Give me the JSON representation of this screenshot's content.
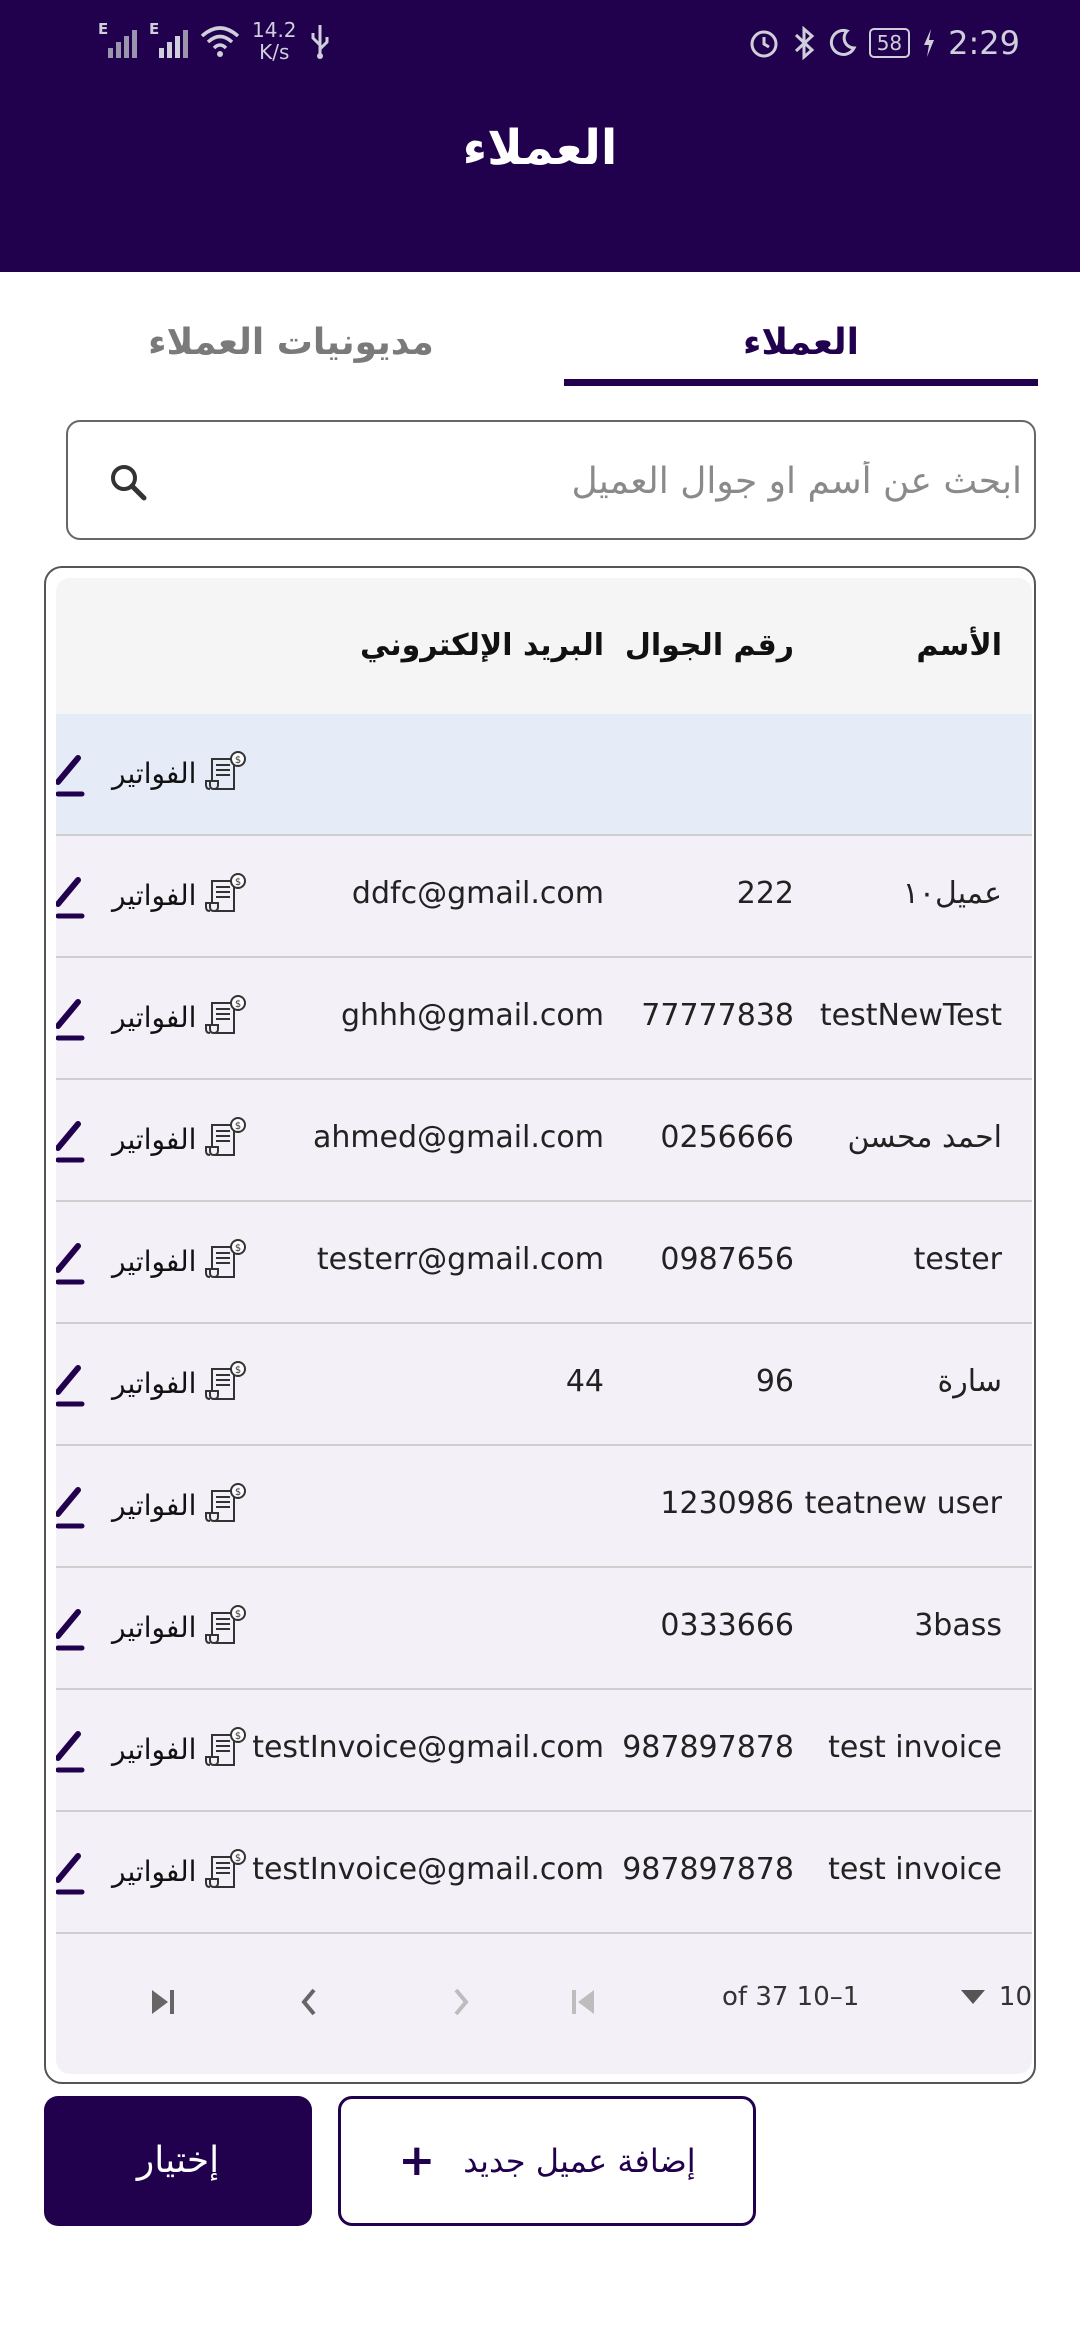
{
  "status_bar": {
    "network_1": "E",
    "network_2": "E",
    "speed_value": "14.2",
    "speed_unit": "K/s",
    "battery": "58",
    "time": "2:29"
  },
  "app_bar": {
    "title": "العملاء"
  },
  "tabs": [
    {
      "label": "العملاء",
      "active": true
    },
    {
      "label": "مديونيات العملاء",
      "active": false
    }
  ],
  "search": {
    "placeholder": "ابحث عن أسم او جوال العميل",
    "value": ""
  },
  "table": {
    "headers": {
      "name": "الأسم",
      "phone": "رقم الجوال",
      "email": "البريد الإلكتروني"
    },
    "invoice_label": "الفواتير",
    "rows": [
      {
        "name": "",
        "phone": "",
        "email": ""
      },
      {
        "name": "عميل١٠",
        "phone": "222",
        "email": "ddfc@gmail.com"
      },
      {
        "name": "testNewTest",
        "phone": "77777838",
        "email": "ghhh@gmail.com"
      },
      {
        "name": "احمد محسن",
        "phone": "0256666",
        "email": "ahmed@gmail.com"
      },
      {
        "name": "tester",
        "phone": "0987656",
        "email": "testerr@gmail.com"
      },
      {
        "name": "سارة",
        "phone": "96",
        "email": "44"
      },
      {
        "name": "teatnew user",
        "phone": "1230986",
        "email": ""
      },
      {
        "name": "3bass",
        "phone": "0333666",
        "email": ""
      },
      {
        "name": "test invoice",
        "phone": "987897878",
        "email": "testInvoice@gmail.com"
      },
      {
        "name": "test invoice",
        "phone": "987897878",
        "email": "testInvoice@gmail.com"
      }
    ]
  },
  "pagination": {
    "rows_per_page": "10",
    "range": "of 37 10–1"
  },
  "buttons": {
    "choose": "إختيار",
    "add_customer": "إضافة عميل جديد"
  }
}
